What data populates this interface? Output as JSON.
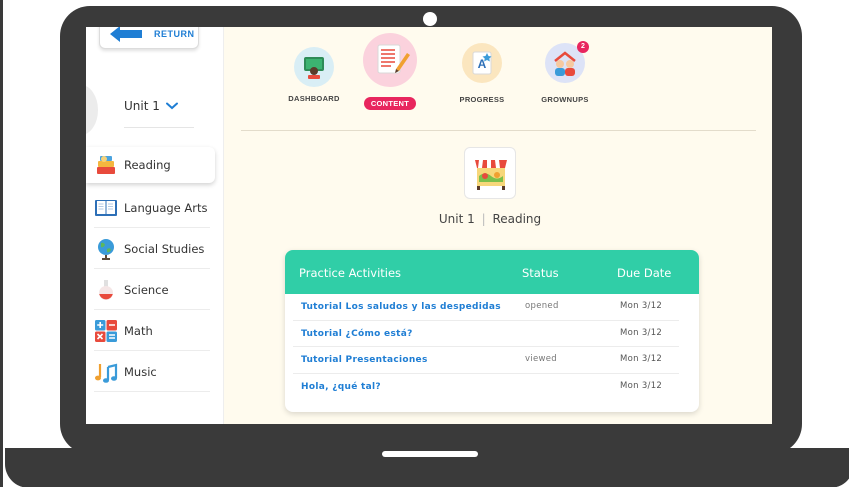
{
  "sidebar": {
    "return_label": "RETURN",
    "unit_selector": "Unit 1",
    "subjects": [
      {
        "label": "Reading",
        "icon": "book-stack-icon"
      },
      {
        "label": "Language Arts",
        "icon": "open-book-icon"
      },
      {
        "label": "Social Studies",
        "icon": "globe-icon"
      },
      {
        "label": "Science",
        "icon": "flask-icon"
      },
      {
        "label": "Math",
        "icon": "math-symbols-icon"
      },
      {
        "label": "Music",
        "icon": "music-notes-icon"
      }
    ]
  },
  "topnav": {
    "dashboard": "DASHBOARD",
    "content": "CONTENT",
    "progress": "PROGRESS",
    "grownups": "GROWNUPS",
    "grownups_badge": "2"
  },
  "main": {
    "unit_label": "Unit 1",
    "separator": "|",
    "subject_label": "Reading",
    "activities": {
      "headers": {
        "activity": "Practice Activities",
        "status": "Status",
        "due": "Due Date"
      },
      "rows": [
        {
          "activity": "Tutorial Los saludos y las despedidas",
          "status": "opened",
          "due": "Mon 3/12"
        },
        {
          "activity": "Tutorial ¿Cómo está?",
          "status": "",
          "due": "Mon 3/12"
        },
        {
          "activity": "Tutorial Presentaciones",
          "status": "viewed",
          "due": "Mon 3/12"
        },
        {
          "activity": "Hola, ¿qué tal?",
          "status": "",
          "due": "Mon 3/12"
        }
      ]
    }
  },
  "colors": {
    "accent_blue": "#1f7ed4",
    "header_green": "#30cea7",
    "pill_pink": "#e8265e",
    "screen_bg": "#fffbee",
    "frame": "#3a3a3a"
  }
}
